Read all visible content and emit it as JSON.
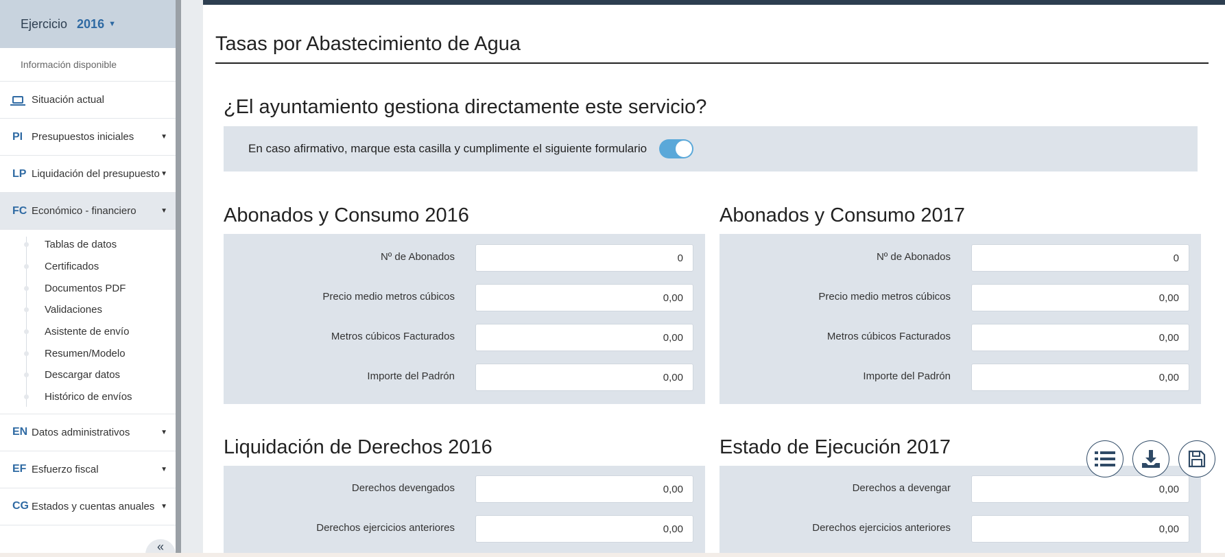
{
  "sidebar": {
    "year_label": "Ejercicio",
    "year_value": "2016",
    "info_label": "Información disponible",
    "current_status": "Situación actual",
    "items": [
      {
        "abbr": "PI",
        "label": "Presupuestos iniciales"
      },
      {
        "abbr": "LP",
        "label": "Liquidación del presupuesto"
      },
      {
        "abbr": "FC",
        "label": "Económico - financiero"
      },
      {
        "abbr": "EN",
        "label": "Datos administrativos"
      },
      {
        "abbr": "EF",
        "label": "Esfuerzo fiscal"
      },
      {
        "abbr": "CG",
        "label": "Estados y cuentas anuales"
      }
    ],
    "sub_items": [
      "Tablas de datos",
      "Certificados",
      "Documentos PDF",
      "Validaciones",
      "Asistente de envío",
      "Resumen/Modelo",
      "Descargar datos",
      "Histórico de envíos"
    ],
    "collapse_symbol": "«"
  },
  "main": {
    "page_title": "Tasas por Abastecimiento de Agua",
    "question": "¿El ayuntamiento gestiona directamente este servicio?",
    "toggle_label": "En caso afirmativo, marque esta casilla y cumplimente el siguiente formulario",
    "toggle_on": true,
    "sections": [
      {
        "title": "Abonados y Consumo 2016",
        "fields": [
          {
            "label": "Nº de Abonados",
            "value": "0"
          },
          {
            "label": "Precio medio metros cúbicos",
            "value": "0,00"
          },
          {
            "label": "Metros cúbicos Facturados",
            "value": "0,00"
          },
          {
            "label": "Importe del Padrón",
            "value": "0,00"
          }
        ]
      },
      {
        "title": "Abonados y Consumo 2017",
        "fields": [
          {
            "label": "Nº de Abonados",
            "value": "0"
          },
          {
            "label": "Precio medio metros cúbicos",
            "value": "0,00"
          },
          {
            "label": "Metros cúbicos Facturados",
            "value": "0,00"
          },
          {
            "label": "Importe del Padrón",
            "value": "0,00"
          }
        ]
      },
      {
        "title": "Liquidación de Derechos 2016",
        "fields": [
          {
            "label": "Derechos devengados",
            "value": "0,00"
          },
          {
            "label": "Derechos ejercicios anteriores",
            "value": "0,00"
          }
        ]
      },
      {
        "title": "Estado de Ejecución 2017",
        "fields": [
          {
            "label": "Derechos a devengar",
            "value": "0,00"
          },
          {
            "label": "Derechos ejercicios anteriores",
            "value": "0,00"
          }
        ]
      }
    ]
  },
  "actions": {
    "icons": [
      "list-icon",
      "download-icon",
      "save-icon"
    ]
  },
  "colors": {
    "accent": "#2f6aa3",
    "topbar": "#2d3e50",
    "panel": "#dde3ea",
    "toggle": "#5aa8d9"
  }
}
